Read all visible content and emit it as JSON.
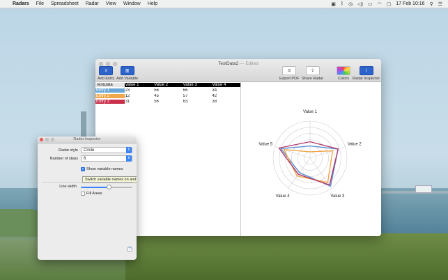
{
  "menubar": {
    "app": "Radars",
    "items": [
      "File",
      "Spreadsheet",
      "Radar",
      "View",
      "Window",
      "Help"
    ],
    "clock": "17 Feb  10:16"
  },
  "window": {
    "title": "TestData2",
    "edited": "— Edited",
    "toolbar": {
      "add_entry": "Add Entry",
      "add_variable": "Add Variable",
      "export_pdf": "Export PDF",
      "share_radar": "Share Radar",
      "colors": "Colors",
      "radar_inspector": "Radar Inspector"
    }
  },
  "table": {
    "headers": [
      "TestData",
      "Value 1",
      "Value 2",
      "Value 3",
      "Value 4"
    ],
    "rows": [
      {
        "name": "Entry 1",
        "color": "#6aa7d6",
        "values": [
          "23",
          "56",
          "66",
          "34"
        ]
      },
      {
        "name": "Entry 2",
        "color": "#f0a64a",
        "values": [
          "12",
          "45",
          "57",
          "42"
        ]
      },
      {
        "name": "Entry 3",
        "color": "#c9304a",
        "values": [
          "31",
          "56",
          "63",
          "38"
        ]
      }
    ]
  },
  "chart_data": {
    "type": "radar",
    "axes": [
      "Value 1",
      "Value 2",
      "Value 3",
      "Value 4",
      "Value 5"
    ],
    "steps": 6,
    "max": 70,
    "series": [
      {
        "name": "Entry 1",
        "color": "#5a8fd6",
        "values": [
          23,
          56,
          66,
          34,
          58
        ]
      },
      {
        "name": "Entry 2",
        "color": "#f0a64a",
        "values": [
          12,
          45,
          57,
          42,
          52
        ]
      },
      {
        "name": "Entry 3",
        "color": "#b23a6a",
        "values": [
          31,
          56,
          63,
          38,
          62
        ]
      }
    ]
  },
  "inspector": {
    "title": "Radar Inspector",
    "radar_style_label": "Radar style",
    "radar_style_value": "Circle",
    "steps_label": "Number of steps",
    "steps_value": "6",
    "show_names_label": "Show variable names",
    "show_names_checked": true,
    "tooltip": "Switch variable names on and off in your Radar",
    "line_width_label": "Line width",
    "line_width_level": 0.55,
    "fill_areas_label": "Fill Areas",
    "fill_areas_checked": false,
    "help": "?"
  }
}
